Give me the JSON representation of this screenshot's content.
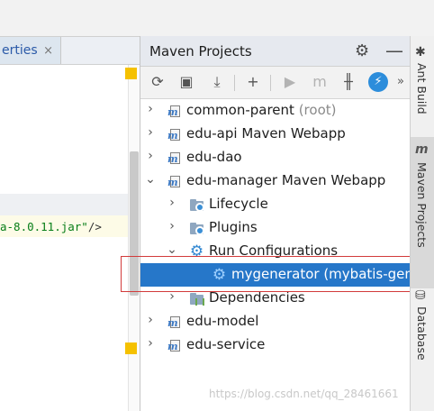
{
  "editor": {
    "tab_label": "erties",
    "tab_close": "×",
    "code_line": "a-8.0.11.jar\"",
    "code_tail": "/>"
  },
  "maven": {
    "title": "Maven Projects",
    "header_icons": [
      "gear-icon",
      "minimize-icon"
    ],
    "toolbar": [
      "reimport-icon",
      "generate-sources-icon",
      "download-icon",
      "add-icon",
      "run-icon",
      "execute-goal-icon",
      "toggle-offline-icon",
      "skip-tests-icon",
      "more-icon"
    ],
    "tree": [
      {
        "label": "common-parent",
        "suffix": "(root)",
        "expanded": false
      },
      {
        "label": "edu-api Maven Webapp",
        "expanded": false
      },
      {
        "label": "edu-dao",
        "expanded": false
      },
      {
        "label": "edu-manager Maven Webapp",
        "expanded": true
      },
      {
        "label": "Lifecycle",
        "expanded": false
      },
      {
        "label": "Plugins",
        "expanded": false
      },
      {
        "label": "Run Configurations",
        "expanded": true
      },
      {
        "label": "mygenerator (mybatis-gene",
        "selected": true
      },
      {
        "label": "Dependencies",
        "expanded": false
      },
      {
        "label": "edu-model",
        "expanded": false
      },
      {
        "label": "edu-service",
        "expanded": false
      }
    ]
  },
  "right_strip": {
    "tabs": [
      {
        "label": "Ant Build",
        "icon": "ant-icon"
      },
      {
        "label": "Maven Projects",
        "icon": "maven-icon",
        "active": true
      },
      {
        "label": "Database",
        "icon": "database-icon"
      }
    ]
  },
  "watermark": "https://blog.csdn.net/qq_28461661"
}
